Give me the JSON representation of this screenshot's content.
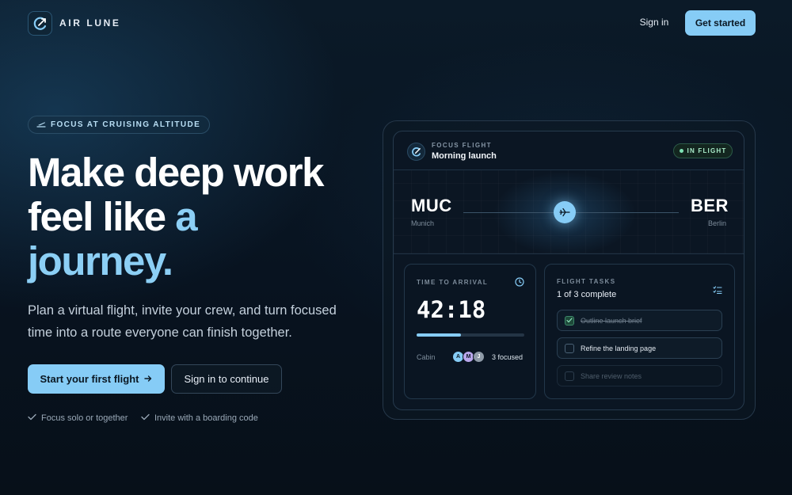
{
  "header": {
    "brand": "AIR LUNE",
    "sign_in": "Sign in",
    "get_started": "Get started"
  },
  "hero": {
    "badge": "FOCUS AT CRUISING ALTITUDE",
    "headline_line1": "Make deep work",
    "headline_line2_a": "feel like ",
    "headline_line2_b": "a",
    "headline_line3": "journey.",
    "subtitle": "Plan a virtual flight, invite your crew, and turn focused time into a route everyone can finish together.",
    "primary_button": "Start your first flight",
    "secondary_button": "Sign in to continue",
    "checks": [
      "Focus solo or together",
      "Invite with a boarding code"
    ]
  },
  "card": {
    "focus_label": "FOCUS FLIGHT",
    "flight_name": "Morning launch",
    "status": "IN FLIGHT",
    "origin": {
      "code": "MUC",
      "city": "Munich"
    },
    "destination": {
      "code": "BER",
      "city": "Berlin"
    },
    "time_label": "TIME TO ARRIVAL",
    "timer": "42:18",
    "progress": 0.41,
    "cabin_label": "Cabin",
    "avatars": [
      "A",
      "M",
      "J"
    ],
    "focused": "3 focused",
    "tasks_label": "FLIGHT TASKS",
    "tasks_summary": "1 of 3 complete",
    "tasks": [
      {
        "label": "Outline launch brief",
        "done": true
      },
      {
        "label": "Refine the landing page",
        "done": false
      },
      {
        "label": "Share review notes",
        "done": false
      }
    ]
  },
  "colors": {
    "accent": "#86ccf6",
    "background": "#081320",
    "status_green": "#7ee2b4"
  },
  "icons": [
    "logo-icon",
    "plane-takeoff-icon",
    "arrow-right-icon",
    "check-icon",
    "plane-icon",
    "clock-icon",
    "task-list-icon"
  ]
}
